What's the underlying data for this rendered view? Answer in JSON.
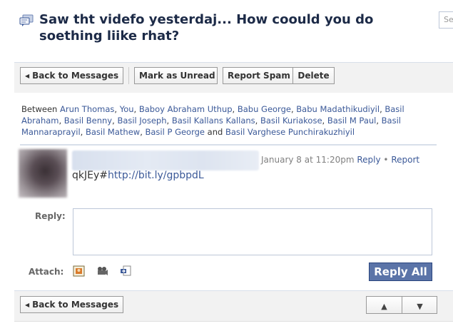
{
  "header": {
    "title": "Saw tht videfo yesterdaj... How coould you do soething liike rhat?",
    "icon": "messages-icon",
    "search_placeholder": "Se"
  },
  "toolbar_top": {
    "back_label": "Back to Messages",
    "mark_unread_label": "Mark as Unread",
    "report_spam_label": "Report Spam",
    "delete_label": "Delete"
  },
  "participants": {
    "prefix": "Between",
    "names": [
      "Arun Thomas",
      "You",
      "Baboy Abraham Uthup",
      "Babu George",
      "Babu Madathikudiyil",
      "Basil Abraham",
      "Basil Benny",
      "Basil Joseph",
      "Basil Kallans Kallans",
      "Basil Kuriakose",
      "Basil M Paul",
      "Basil Mannaraprayil",
      "Basil Mathew",
      "Basil P George",
      "Basil Varghese Punchirakuzhiyil"
    ],
    "separator": ", ",
    "and_word": " and "
  },
  "message": {
    "timestamp": "January 8 at 11:20pm",
    "reply_link": "Reply",
    "dot": " • ",
    "report_link": "Report",
    "body_prefix": "qkJEy#",
    "body_link": "http://bit.ly/gpbpdL"
  },
  "reply_form": {
    "reply_label": "Reply:",
    "reply_value": "",
    "attach_label": "Attach:",
    "attach_icons": [
      "photo-attach-icon",
      "video-attach-icon",
      "link-attach-icon"
    ],
    "submit_label": "Reply All"
  },
  "toolbar_bottom": {
    "back_label": "Back to Messages",
    "prev_glyph": "▲",
    "next_glyph": "▼"
  },
  "colors": {
    "link": "#3b5998",
    "primary_button": "#5b74a8",
    "title": "#1c2a47"
  }
}
